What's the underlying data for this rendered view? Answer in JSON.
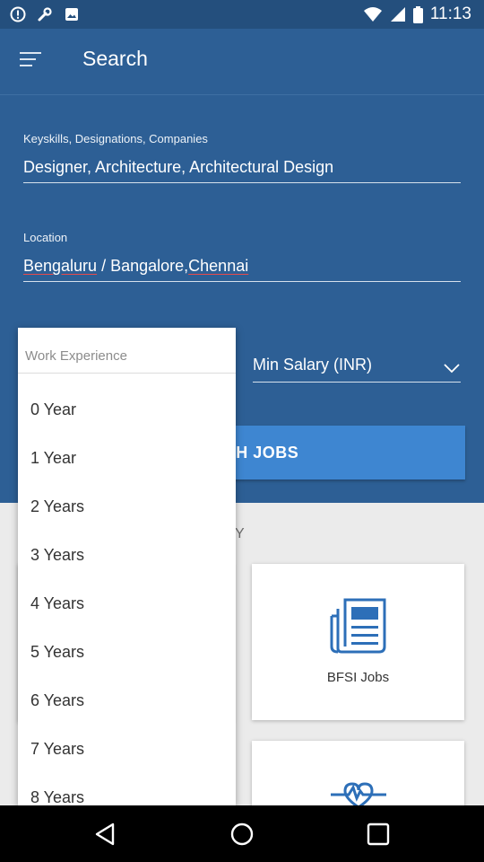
{
  "status_bar": {
    "time": "11:13",
    "left_icons": [
      "alert-circle-icon",
      "wrench-icon",
      "image-icon"
    ],
    "right_icons": [
      "wifi-icon",
      "signal-icon",
      "battery-icon"
    ]
  },
  "app_bar": {
    "title": "Search",
    "menu_icon": "hamburger-menu-icon"
  },
  "form": {
    "keyskills": {
      "label": "Keyskills, Designations, Companies",
      "value": "Designer, Architecture, Architectural Design"
    },
    "location": {
      "label": "Location",
      "value_part1": "Bengaluru",
      "value_part2": " / Bangalore,",
      "value_part3": "Chennai"
    },
    "min_salary": {
      "placeholder": "Min Salary (INR)",
      "icon": "chevron-down-icon"
    },
    "search_button": "SEARCH JOBS",
    "search_button_visible": "CH JOBS"
  },
  "section_heading_visible": "Y",
  "cards": [
    {
      "label": "BFSI Jobs",
      "icon": "newspaper-icon"
    },
    {
      "label": "",
      "icon": "heartbeat-icon"
    }
  ],
  "work_experience_dropdown": {
    "header": "Work Experience",
    "options": [
      "0 Year",
      "1 Year",
      "2 Years",
      "3 Years",
      "4 Years",
      "5 Years",
      "6 Years",
      "7 Years",
      "8 Years"
    ]
  },
  "nav_bar": {
    "buttons": [
      "back-icon",
      "home-icon",
      "recents-icon"
    ]
  },
  "colors": {
    "primary": "#2d5f95",
    "status_bar": "#244f7d",
    "button": "#3e86d1",
    "background": "#ebebeb"
  }
}
